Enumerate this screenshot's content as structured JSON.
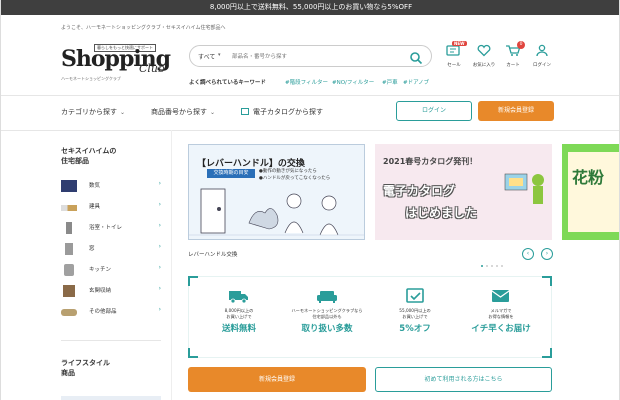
{
  "announcement": "8,000円以上で送料無料、55,000円以上のお買い物なら5%OFF",
  "welcome": "ようこそ、ハーモネートショッピングクラブ・セキスイハイム住宅部品へ",
  "logo": {
    "tag": "暮らしをもっと快適にサポート",
    "main": "Shopping",
    "club": "Club",
    "sub": "ハーモネートショッピングクラブ"
  },
  "search": {
    "category": "すべて",
    "placeholder": "部品名・番号から探す"
  },
  "keywords": {
    "label": "よく調べられているキーワード",
    "items": [
      "#階段フィルター",
      "#NO/フィルター",
      "#戸車",
      "#ドアノブ"
    ]
  },
  "header_icons": [
    {
      "label": "セール",
      "icon": "sale-icon",
      "badge": "NEW"
    },
    {
      "label": "お気に入り",
      "icon": "heart-icon",
      "badge": ""
    },
    {
      "label": "カート",
      "icon": "cart-icon",
      "badge": "0"
    },
    {
      "label": "ログイン",
      "icon": "user-icon",
      "badge": ""
    }
  ],
  "nav": {
    "category": "カテゴリから探す",
    "product_no": "商品番号から探す",
    "catalog": "電子カタログから探す",
    "login": "ログイン",
    "register": "新規会員登録"
  },
  "sidebar": {
    "title1": "セキスイハイムの\n住宅部品",
    "items": [
      {
        "label": "数気",
        "thumb": "#2f3d70"
      },
      {
        "label": "建具",
        "thumb": "#c9a15a"
      },
      {
        "label": "浴室・トイレ",
        "thumb": "#8a8a8a"
      },
      {
        "label": "窓",
        "thumb": "#9a9a9a"
      },
      {
        "label": "キッチン",
        "thumb": "#a0a0a0"
      },
      {
        "label": "玄関収納",
        "thumb": "#8a6a48"
      },
      {
        "label": "その他部品",
        "thumb": "#b8a070"
      }
    ],
    "title2": "ライフスタイル\n商品"
  },
  "banners": {
    "b1_title": "【レバーハンドル】の交換",
    "b1_box": "交換時期の目安",
    "b1_note1": "●動作の動きが気になったら",
    "b1_note2": "●ハンドルが戻ってこなくなったら",
    "b2_headline": "2021春号カタログ発刊！",
    "b2_main1": "電子カタログ",
    "b2_main2": "はじめました",
    "b3_text": "花粉",
    "caption": "レバーハンドル交換"
  },
  "benefits": [
    {
      "small": "8,000円以上の\nお買い上げで",
      "big": "送料無料",
      "icon": "truck-icon"
    },
    {
      "small": "ハーモネートショッピングクラブなら\n住宅部品以外も",
      "big": "取り扱い多数",
      "icon": "sofa-icon"
    },
    {
      "small": "55,000円以上の\nお買い上げで",
      "big": "5%オフ",
      "icon": "discount-icon"
    },
    {
      "small": "メルマガで\nお得な情報を",
      "big": "イチ早くお届け",
      "icon": "mail-icon"
    }
  ],
  "cta": {
    "register": "新規会員登録",
    "first_time": "初めて利用される方はこちら"
  },
  "colors": {
    "accent": "#2a9d9a",
    "orange": "#e8892a",
    "topbar": "#3f3f3f"
  }
}
